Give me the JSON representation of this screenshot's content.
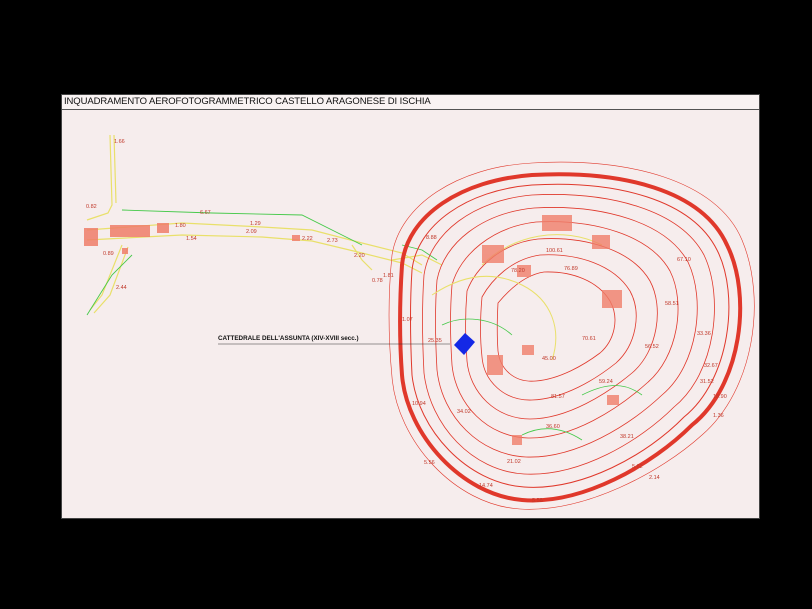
{
  "title": "INQUADRAMENTO AEROFOTOGRAMMETRICO CASTELLO ARAGONESE DI ISCHIA",
  "callout": "CATTEDRALE DELL'ASSUNTA (XIV-XVIII secc.)",
  "colors": {
    "background": "#f6eded",
    "contour": "#e0382b",
    "road": "#e9e06a",
    "vegetation": "#46c94a",
    "building": "#f07e6a",
    "cathedral": "#1428e6"
  },
  "elevations": [
    "1.66",
    "0.82",
    "6.67",
    "1.29",
    "1.80",
    "2.09",
    "1.54",
    "2.22",
    "2.73",
    "0.89",
    "2.44",
    "2.20",
    "0.78",
    "1.81",
    "8.88",
    "100.61",
    "78.20",
    "76.89",
    "67.10",
    "58.51",
    "33.36",
    "32.67",
    "70.61",
    "45.00",
    "56.52",
    "31.52",
    "18.90",
    "1.36",
    "81.57",
    "59.24",
    "10.94",
    "34.02",
    "36.60",
    "38.21",
    "5.56",
    "21.02",
    "2.14",
    "14.74",
    "5.58",
    "5.62",
    "1.07",
    "25.35"
  ]
}
